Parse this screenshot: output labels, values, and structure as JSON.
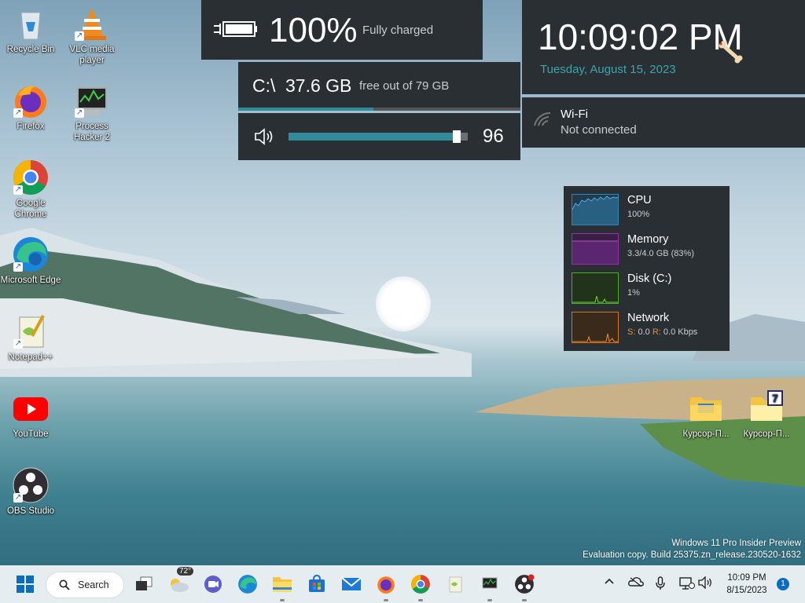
{
  "desktop": {
    "icons": [
      {
        "label": "Recycle Bin"
      },
      {
        "label": "VLC media player"
      },
      {
        "label": "Firefox"
      },
      {
        "label": "Process Hacker 2"
      },
      {
        "label": "Google Chrome"
      },
      {
        "label": "Microsoft Edge"
      },
      {
        "label": "Notepad++"
      },
      {
        "label": "YouTube"
      },
      {
        "label": "OBS Studio"
      },
      {
        "label": "Курсор-П..."
      },
      {
        "label": "Курсор-П..."
      }
    ]
  },
  "widgets": {
    "battery": {
      "percent": "100%",
      "status": "Fully charged"
    },
    "disk": {
      "letter": "C:\\",
      "free": "37.6 GB",
      "total": "free out of 79 GB",
      "free_fraction": 0.48
    },
    "volume": {
      "level": "96",
      "level_fraction": 0.96
    },
    "clock": {
      "time": "10:09:02 PM",
      "date": "Tuesday, August 15, 2023"
    },
    "wifi": {
      "name": "Wi-Fi",
      "status": "Not connected"
    },
    "perf": {
      "cpu": {
        "label": "CPU",
        "value": "100%",
        "color": "#2e86c1"
      },
      "memory": {
        "label": "Memory",
        "value": "3.3/4.0 GB (83%)",
        "color": "#9b2fae"
      },
      "disk": {
        "label": "Disk (C:)",
        "value": "1%",
        "color": "#4caf20"
      },
      "network": {
        "label": "Network",
        "send_label": "S:",
        "send": "0.0",
        "recv_label": "R:",
        "recv": "0.0 Kbps",
        "color": "#d9741a"
      }
    }
  },
  "watermark": {
    "line1": "Windows 11 Pro Insider Preview",
    "line2": "Evaluation copy. Build 25375.zn_release.230520-1632"
  },
  "taskbar": {
    "search_label": "Search",
    "weather_temp": "72°",
    "apps": [
      "start-icon",
      "task-view-icon",
      "weather-icon",
      "meet-icon",
      "edge-icon",
      "file-explorer-icon",
      "store-icon",
      "mail-icon",
      "firefox-icon",
      "chrome-icon",
      "notepadpp-icon",
      "process-hacker-icon",
      "obs-icon"
    ],
    "clock_time": "10:09 PM",
    "clock_date": "8/15/2023",
    "notification_count": "1"
  }
}
